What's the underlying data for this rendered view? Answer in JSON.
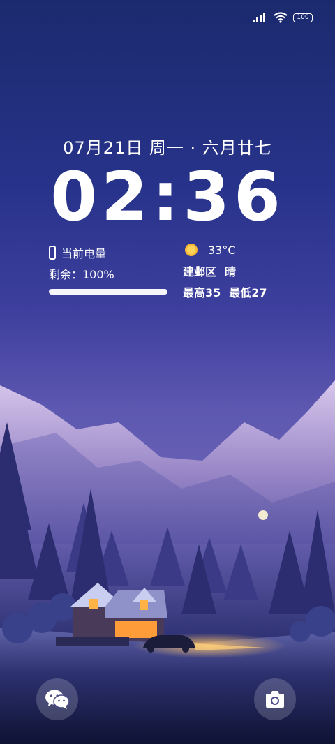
{
  "status_bar": {
    "battery_level": "100",
    "signal_icon": "signal-bars-icon",
    "wifi_icon": "wifi-icon"
  },
  "lockscreen": {
    "date": "07月21日 周一 · 六月廿七",
    "time": "02:36"
  },
  "battery_widget": {
    "title": "当前电量",
    "remaining": "剩余：100%",
    "level": 1.0
  },
  "weather_widget": {
    "temperature": "33°C",
    "location": "建邺区",
    "condition": "晴",
    "high": "最高35",
    "low": "最低27",
    "icon": "sun-icon"
  },
  "shortcuts": {
    "left_icon": "wechat-icon",
    "right_icon": "camera-icon"
  },
  "colors": {
    "sky_top": "#1b2a6e",
    "mountain": "#b6a4d8",
    "window_glow": "#ffb347"
  }
}
